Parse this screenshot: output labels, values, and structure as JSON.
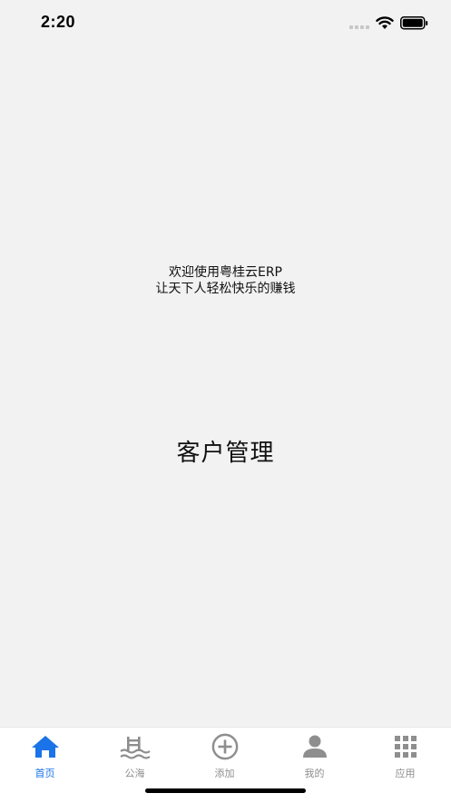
{
  "status_bar": {
    "time": "2:20",
    "icons": [
      "signal-icon",
      "wifi-icon",
      "battery-icon"
    ]
  },
  "welcome": {
    "line1": "欢迎使用粤桂云ERP",
    "line2": "让天下人轻松快乐的赚钱"
  },
  "main": {
    "title": "客户管理"
  },
  "tab_bar": {
    "active_color": "#1a73e8",
    "inactive_color": "#8e8e8e",
    "tabs": [
      {
        "label": "首页",
        "icon": "home-icon",
        "active": true
      },
      {
        "label": "公海",
        "icon": "sea-icon",
        "active": false
      },
      {
        "label": "添加",
        "icon": "add-circle-icon",
        "active": false
      },
      {
        "label": "我的",
        "icon": "person-icon",
        "active": false
      },
      {
        "label": "应用",
        "icon": "grid-icon",
        "active": false
      }
    ]
  }
}
